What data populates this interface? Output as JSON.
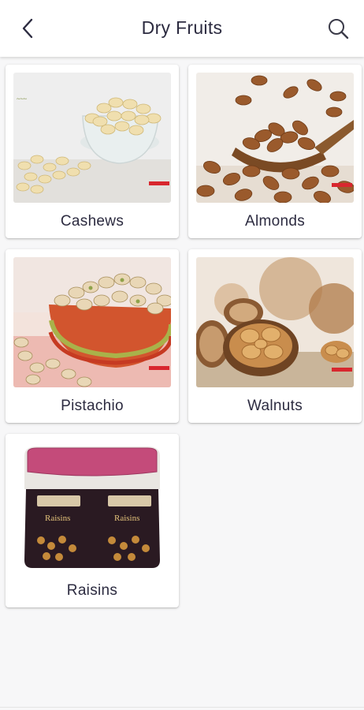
{
  "header": {
    "title": "Dry Fruits",
    "back_icon": "chevron-left-icon",
    "search_icon": "search-icon"
  },
  "products": [
    {
      "label": "Cashews"
    },
    {
      "label": "Almonds"
    },
    {
      "label": "Pistachio"
    },
    {
      "label": "Walnuts"
    },
    {
      "label": "Raisins"
    }
  ],
  "colors": {
    "title_text": "#2c2b40",
    "background": "#f7f7f8",
    "card": "#ffffff"
  }
}
